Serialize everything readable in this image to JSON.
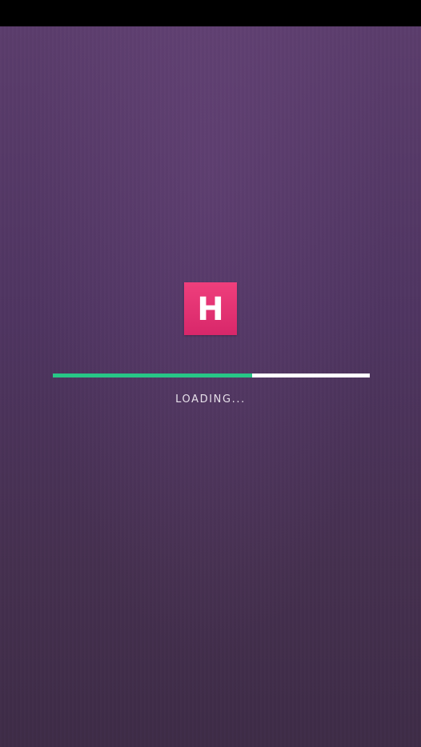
{
  "logo": {
    "letter": "H",
    "color_top": "#ef3f7c",
    "color_bottom": "#d8276a"
  },
  "progress": {
    "fraction": 0.63,
    "fill_color": "#27c787",
    "track_color": "#ffffff"
  },
  "status": {
    "text": "LOADING..."
  },
  "background": {
    "color_top": "#5b3d6c",
    "color_bottom": "#3e2c47"
  }
}
